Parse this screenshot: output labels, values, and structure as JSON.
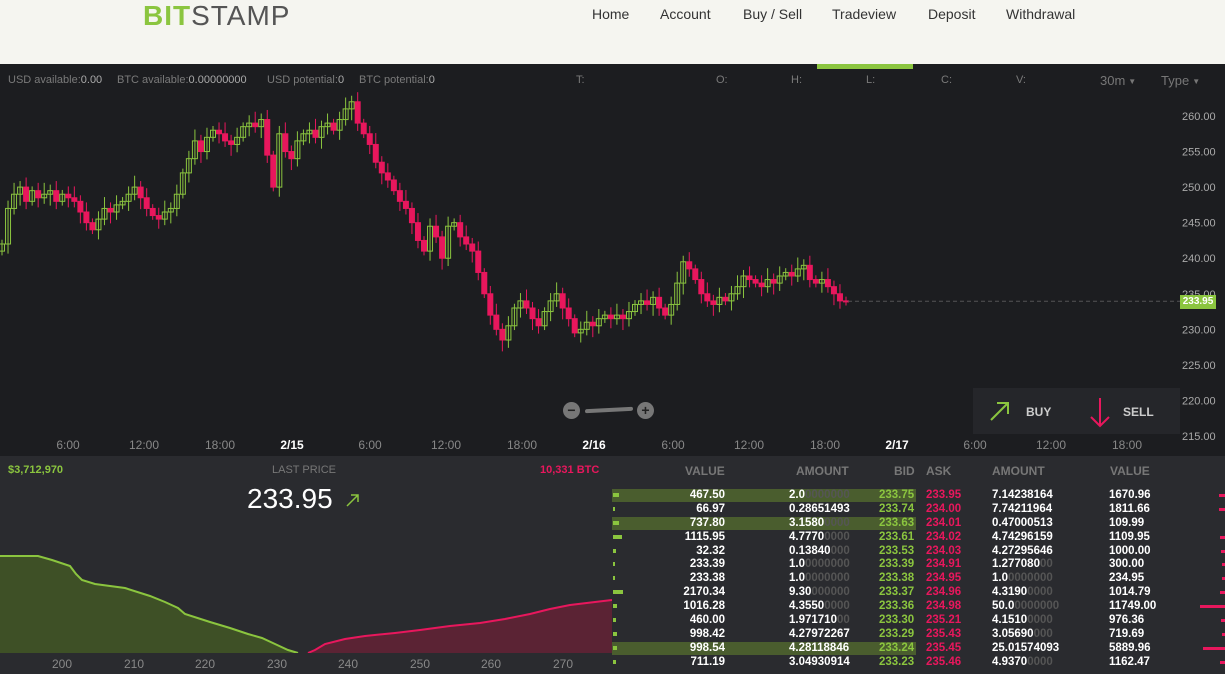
{
  "header": {
    "logo_part1": "BIT",
    "logo_part2": "STAMP",
    "nav": [
      "Home",
      "Account",
      "Buy / Sell",
      "Tradeview",
      "Deposit",
      "Withdrawal"
    ],
    "active_nav": "Tradeview"
  },
  "infobar": {
    "usd_available_label": "USD available:",
    "usd_available": "0.00",
    "btc_available_label": "BTC available:",
    "btc_available": "0.00000000",
    "usd_potential_label": "USD potential:",
    "usd_potential": "0",
    "btc_potential_label": "BTC potential:",
    "btc_potential": "0",
    "t_label": "T:",
    "o_label": "O:",
    "h_label": "H:",
    "l_label": "L:",
    "c_label": "C:",
    "v_label": "V:",
    "interval": "30m",
    "type": "Type"
  },
  "chart_data": {
    "type": "candlestick",
    "current_price": "233.95",
    "y_ticks": [
      "260.00",
      "255.00",
      "250.00",
      "245.00",
      "240.00",
      "235.00",
      "230.00",
      "225.00",
      "220.00",
      "215.00"
    ],
    "x_ticks": [
      "6:00",
      "12:00",
      "18:00",
      "2/15",
      "6:00",
      "12:00",
      "18:00",
      "2/16",
      "6:00",
      "12:00",
      "18:00",
      "2/17",
      "6:00",
      "12:00",
      "18:00"
    ],
    "x_ticks_bold": [
      "2/15",
      "2/16",
      "2/17"
    ],
    "ylim": [
      215,
      262
    ],
    "up_color": "#8bc53f",
    "down_color": "#e8175d",
    "closes": [
      242,
      247,
      249,
      250,
      248,
      249.5,
      248.5,
      249,
      249.5,
      248,
      249,
      248.5,
      248,
      246.5,
      245,
      244,
      245.5,
      247,
      246.5,
      247.5,
      248,
      249,
      250,
      248.5,
      247,
      246,
      245.5,
      246.5,
      247,
      249,
      252,
      254,
      256.5,
      255,
      257,
      258,
      257.5,
      256.5,
      256,
      257,
      258.5,
      259,
      258.5,
      259.5,
      254.5,
      250,
      257.5,
      255,
      254,
      256.5,
      257.5,
      258,
      257,
      258.5,
      259,
      258,
      259.5,
      261,
      262,
      259,
      257.5,
      256,
      253.5,
      252,
      251,
      249.5,
      248,
      247,
      245,
      242.5,
      241,
      244.5,
      243,
      240,
      244.5,
      245,
      243,
      242,
      241,
      238,
      235,
      232,
      230,
      228.5,
      230.5,
      233,
      234,
      233,
      231.5,
      230.5,
      232.5,
      234,
      235,
      233,
      231.5,
      229.5,
      230,
      231,
      230.5,
      231.5,
      232,
      231.5,
      232,
      231.5,
      232.5,
      233.5,
      234,
      233.5,
      234.5,
      233,
      232,
      233.5,
      236.5,
      239.5,
      238.5,
      237,
      235,
      234,
      233.5,
      234.5,
      234,
      235,
      236,
      237.5,
      237,
      236.5,
      236,
      237,
      236.5,
      237.5,
      238,
      237.5,
      238.5,
      239,
      237,
      236.5,
      237,
      236,
      235,
      234,
      233.95
    ]
  },
  "zoom": {
    "minus": "−",
    "plus": "+"
  },
  "trade": {
    "buy": "BUY",
    "sell": "SELL"
  },
  "depth": {
    "bid_total": "$3,712,970",
    "last_price_label": "LAST PRICE",
    "last_price": "233.95",
    "ask_total": "10,331 BTC",
    "x_ticks": [
      "200",
      "210",
      "220",
      "230",
      "240",
      "250",
      "260",
      "270"
    ]
  },
  "orderbook": {
    "headers": [
      "VALUE",
      "AMOUNT",
      "BID",
      "ASK",
      "AMOUNT",
      "VALUE"
    ],
    "rows": [
      {
        "bid_value": "467.50",
        "bid_amount": "2.0",
        "bid_amount_pad": "0000000",
        "bid": "233.75",
        "ask": "233.95",
        "ask_amount": "7.14238164",
        "ask_amount_pad": "",
        "ask_value": "1670.96",
        "hl": true
      },
      {
        "bid_value": "66.97",
        "bid_amount": "0.28651493",
        "bid_amount_pad": "",
        "bid": "233.74",
        "ask": "234.00",
        "ask_amount": "7.74211964",
        "ask_amount_pad": "",
        "ask_value": "1811.66",
        "hl": false
      },
      {
        "bid_value": "737.80",
        "bid_amount": "3.1580",
        "bid_amount_pad": "0000",
        "bid": "233.63",
        "ask": "234.01",
        "ask_amount": "0.47000513",
        "ask_amount_pad": "",
        "ask_value": "109.99",
        "hl": true
      },
      {
        "bid_value": "1115.95",
        "bid_amount": "4.7770",
        "bid_amount_pad": "0000",
        "bid": "233.61",
        "ask": "234.02",
        "ask_amount": "4.74296159",
        "ask_amount_pad": "",
        "ask_value": "1109.95",
        "hl": false
      },
      {
        "bid_value": "32.32",
        "bid_amount": "0.13840",
        "bid_amount_pad": "000",
        "bid": "233.53",
        "ask": "234.03",
        "ask_amount": "4.27295646",
        "ask_amount_pad": "",
        "ask_value": "1000.00",
        "hl": false
      },
      {
        "bid_value": "233.39",
        "bid_amount": "1.0",
        "bid_amount_pad": "0000000",
        "bid": "233.39",
        "ask": "234.91",
        "ask_amount": "1.277080",
        "ask_amount_pad": "00",
        "ask_value": "300.00",
        "hl": false
      },
      {
        "bid_value": "233.38",
        "bid_amount": "1.0",
        "bid_amount_pad": "0000000",
        "bid": "233.38",
        "ask": "234.95",
        "ask_amount": "1.0",
        "ask_amount_pad": "0000000",
        "ask_value": "234.95",
        "hl": false
      },
      {
        "bid_value": "2170.34",
        "bid_amount": "9.30",
        "bid_amount_pad": "000000",
        "bid": "233.37",
        "ask": "234.96",
        "ask_amount": "4.3190",
        "ask_amount_pad": "0000",
        "ask_value": "1014.79",
        "hl": false
      },
      {
        "bid_value": "1016.28",
        "bid_amount": "4.3550",
        "bid_amount_pad": "0000",
        "bid": "233.36",
        "ask": "234.98",
        "ask_amount": "50.0",
        "ask_amount_pad": "0000000",
        "ask_value": "11749.00",
        "hl": false
      },
      {
        "bid_value": "460.00",
        "bid_amount": "1.971710",
        "bid_amount_pad": "00",
        "bid": "233.30",
        "ask": "235.21",
        "ask_amount": "4.1510",
        "ask_amount_pad": "0000",
        "ask_value": "976.36",
        "hl": false
      },
      {
        "bid_value": "998.42",
        "bid_amount": "4.27972267",
        "bid_amount_pad": "",
        "bid": "233.29",
        "ask": "235.43",
        "ask_amount": "3.05690",
        "ask_amount_pad": "000",
        "ask_value": "719.69",
        "hl": false
      },
      {
        "bid_value": "998.54",
        "bid_amount": "4.28118846",
        "bid_amount_pad": "",
        "bid": "233.24",
        "ask": "235.45",
        "ask_amount": "25.01574093",
        "ask_amount_pad": "",
        "ask_value": "5889.96",
        "hl": true
      },
      {
        "bid_value": "711.19",
        "bid_amount": "3.04930914",
        "bid_amount_pad": "",
        "bid": "233.23",
        "ask": "235.46",
        "ask_amount": "4.9370",
        "ask_amount_pad": "0000",
        "ask_value": "1162.47",
        "hl": false
      }
    ]
  }
}
